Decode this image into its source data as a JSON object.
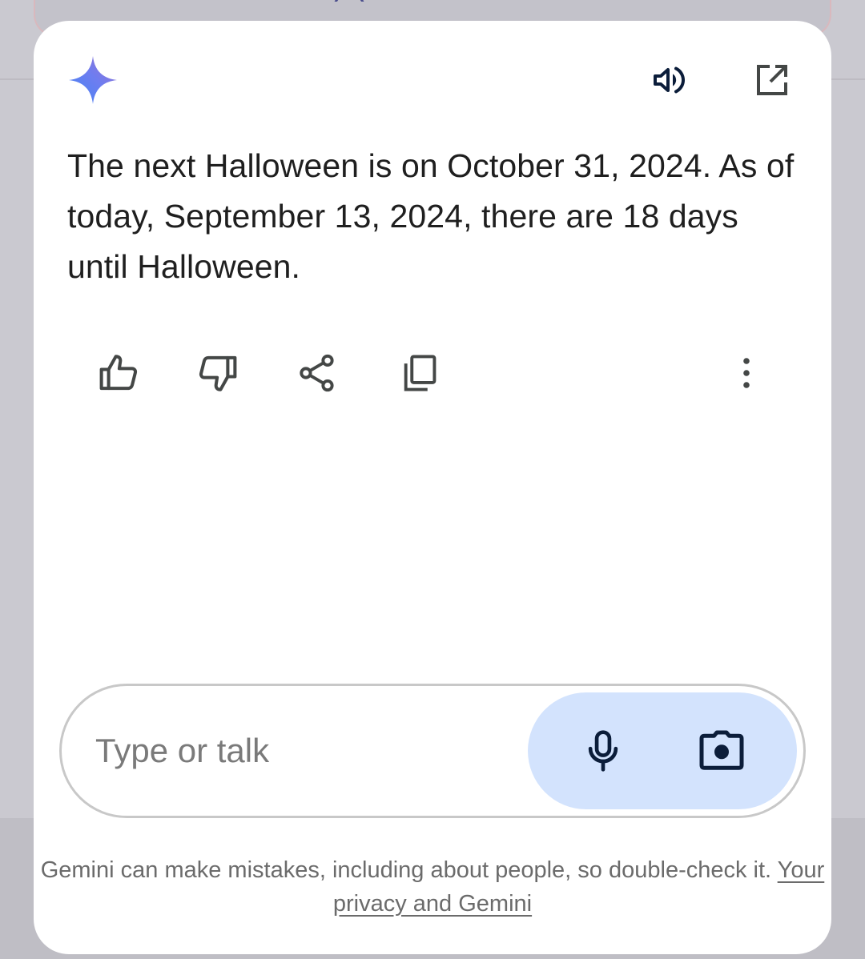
{
  "assistant": {
    "name": "Gemini",
    "response_text": "The next Halloween is on October 31, 2024. As of today, September 13, 2024, there are 18 days until Halloween."
  },
  "header": {
    "icons": [
      "gemini-sparkle-icon",
      "speaker-icon",
      "open-in-new-icon"
    ]
  },
  "actions": {
    "icons": [
      "thumbs-up-icon",
      "thumbs-down-icon",
      "share-icon",
      "copy-icon",
      "more-vert-icon"
    ]
  },
  "input": {
    "placeholder": "Type or talk",
    "value": "",
    "icons": [
      "mic-icon",
      "camera-icon"
    ]
  },
  "footer": {
    "disclaimer_text": "Gemini can make mistakes, including about people, so double-check it.",
    "privacy_link": "Your privacy and Gemini"
  },
  "colors": {
    "accent_pill": "#d3e3fd",
    "icon_dark": "#0b1d3a",
    "icon_gray": "#444746",
    "text_primary": "#1f1f1f",
    "text_secondary": "#6b6b6b"
  }
}
